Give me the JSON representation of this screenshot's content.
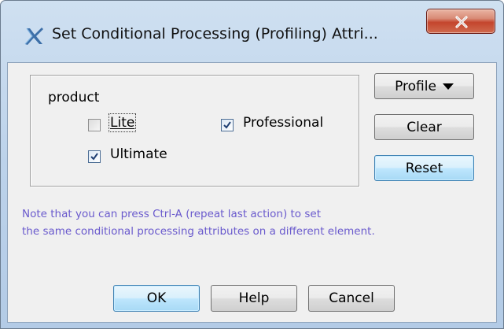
{
  "window": {
    "title": "Set Conditional Processing (Profiling) Attri..."
  },
  "group": {
    "attribute_name": "product",
    "options": [
      {
        "label": "Lite",
        "checked": false
      },
      {
        "label": "Professional",
        "checked": true
      },
      {
        "label": "Ultimate",
        "checked": true
      }
    ]
  },
  "side_buttons": {
    "profile_label": "Profile",
    "clear_label": "Clear",
    "reset_label": "Reset"
  },
  "note": {
    "line1": "Note that you can press Ctrl-A (repeat last action) to set",
    "line2": "the same conditional processing attributes on a different element."
  },
  "footer": {
    "ok_label": "OK",
    "help_label": "Help",
    "cancel_label": "Cancel"
  },
  "colors": {
    "note_text": "#6a5acd",
    "default_button_border": "#3c7fb1",
    "close_button_red": "#c4452d"
  }
}
